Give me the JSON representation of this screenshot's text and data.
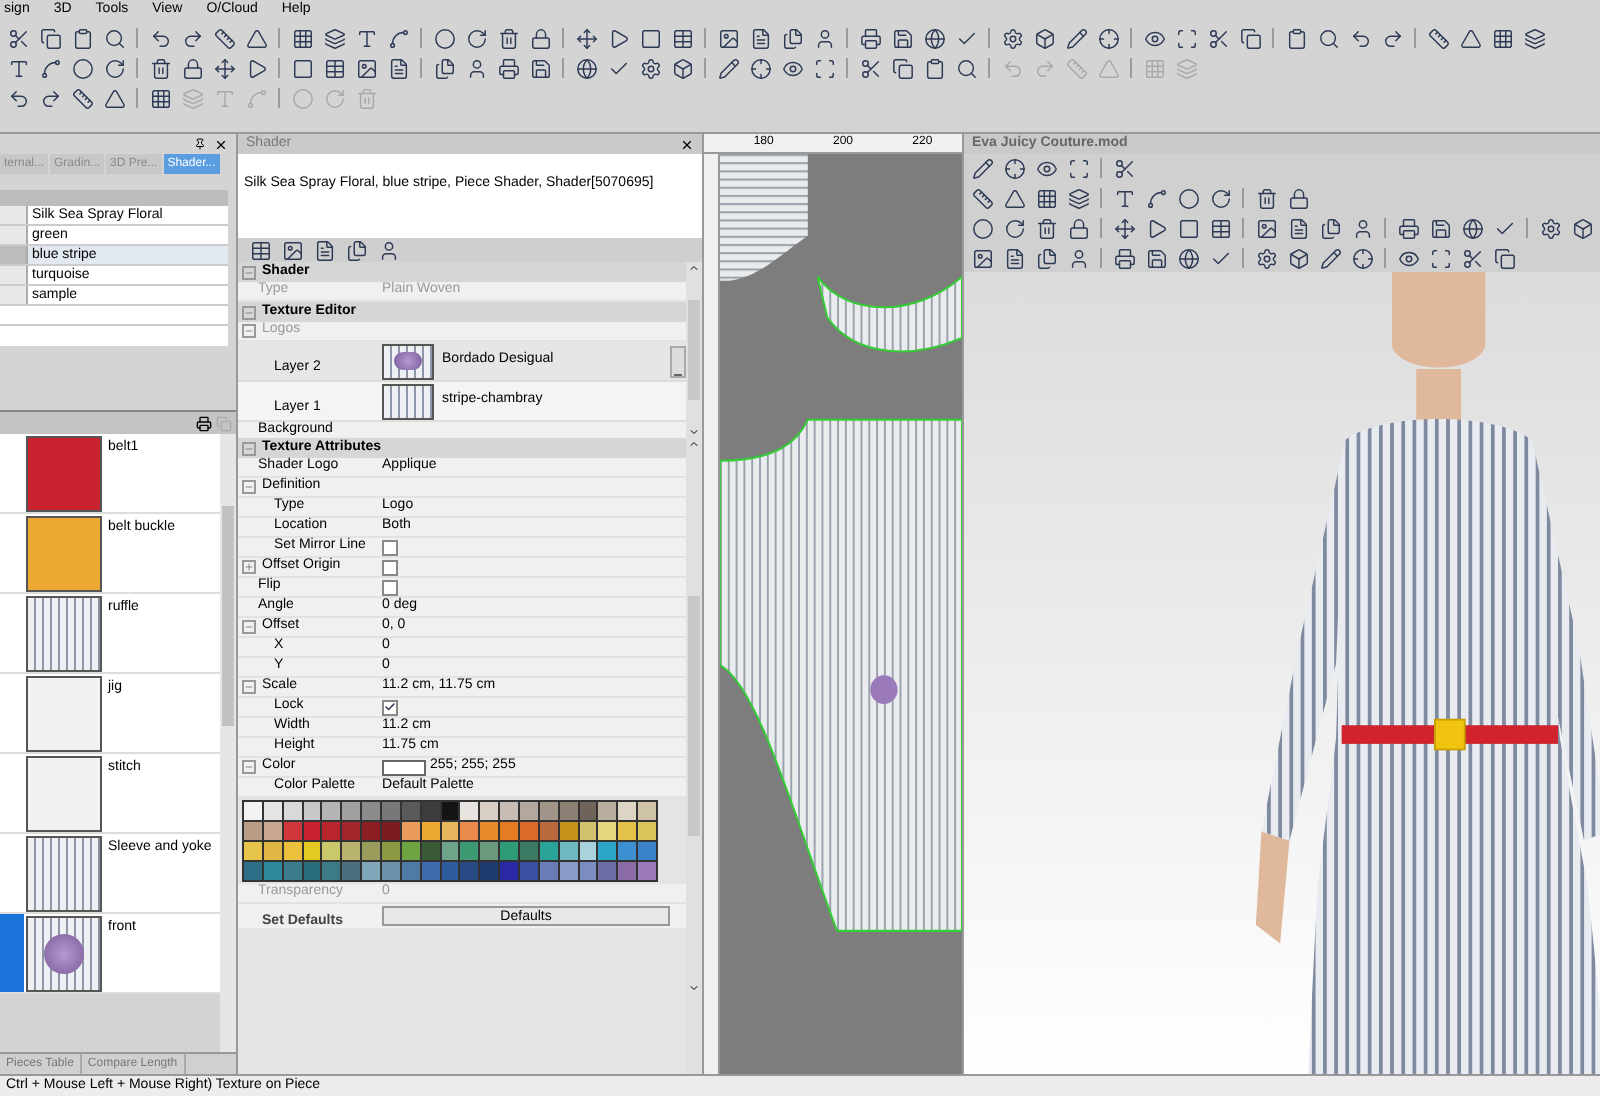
{
  "menu": [
    "sign",
    "3D",
    "Tools",
    "View",
    "O/Cloud",
    "Help"
  ],
  "left_panel": {
    "tabs": [
      {
        "label": "ternal...",
        "selected": false
      },
      {
        "label": "Gradin...",
        "selected": false
      },
      {
        "label": "3D Pre...",
        "selected": false
      },
      {
        "label": "Shader...",
        "selected": true
      }
    ],
    "table_rows": [
      {
        "name": "Silk Sea Spray Floral",
        "selected": false
      },
      {
        "name": "green",
        "selected": false
      },
      {
        "name": "blue stripe",
        "selected": true
      },
      {
        "name": "turquoise",
        "selected": false
      },
      {
        "name": "sample",
        "selected": false
      }
    ],
    "swatches": [
      {
        "name": "belt1",
        "kind": "solid",
        "color": "#c8232e",
        "selected": false
      },
      {
        "name": "belt buckle",
        "kind": "solid",
        "color": "#eba832",
        "selected": false
      },
      {
        "name": "ruffle",
        "kind": "stripe",
        "selected": false
      },
      {
        "name": "jig",
        "kind": "solid",
        "color": "#f1f1f1",
        "selected": false
      },
      {
        "name": "stitch",
        "kind": "solid",
        "color": "#f1f1f1",
        "selected": false
      },
      {
        "name": "Sleeve and yoke",
        "kind": "stripe",
        "selected": false
      },
      {
        "name": "front",
        "kind": "floral",
        "selected": true
      }
    ],
    "bottom_tabs": [
      "Pieces Table",
      "Compare Length"
    ]
  },
  "shader": {
    "title": "Shader",
    "description": "Silk Sea Spray Floral, blue stripe, Piece Shader, Shader[5070695]",
    "upper": [
      {
        "kind": "section",
        "label": "Shader",
        "expanded": true,
        "children": [
          {
            "kind": "prop",
            "label": "Type",
            "value": "Plain Woven",
            "disabled": true
          }
        ]
      },
      {
        "kind": "section",
        "label": "Texture Editor",
        "expanded": true,
        "children": [
          {
            "kind": "group",
            "label": "Logos",
            "disabled": true,
            "expanded": true,
            "children": [
              {
                "kind": "floral_layer",
                "label": "Layer  2",
                "value": "Bordado Desigual",
                "selected": true
              },
              {
                "kind": "stripe_layer",
                "label": "Layer  1",
                "value": "stripe-chambray",
                "selected": false
              }
            ]
          },
          {
            "kind": "prop",
            "label": "Background",
            "disabled": false
          }
        ]
      }
    ],
    "lower": [
      {
        "kind": "section",
        "label": "Texture Attributes",
        "expanded": true,
        "children": [
          {
            "kind": "prop",
            "label": "Shader Logo",
            "value": "Applique",
            "disabled": false
          },
          {
            "kind": "group",
            "label": "Definition",
            "expanded": true,
            "children": [
              {
                "kind": "prop",
                "label": "Type",
                "value": "Logo",
                "disabled": false
              },
              {
                "kind": "prop",
                "label": "Location",
                "value": "Both",
                "disabled": false
              },
              {
                "kind": "check",
                "label": "Set Mirror Line",
                "checked": false
              }
            ]
          },
          {
            "kind": "check",
            "label": "Offset Origin",
            "checked": false,
            "expanded": false
          },
          {
            "kind": "check",
            "label": "Flip",
            "checked": false
          },
          {
            "kind": "prop",
            "label": "Angle",
            "value": "0 deg",
            "disabled": false
          },
          {
            "kind": "group",
            "label": "Offset",
            "value": "0, 0",
            "expanded": true,
            "children": [
              {
                "kind": "prop",
                "label": "X",
                "value": "0",
                "disabled": false
              },
              {
                "kind": "prop",
                "label": "Y",
                "value": "0",
                "disabled": false
              }
            ]
          },
          {
            "kind": "group",
            "label": "Scale",
            "value": "11.2 cm, 11.75 cm",
            "expanded": true,
            "children": [
              {
                "kind": "check",
                "label": "Lock",
                "checked": true
              },
              {
                "kind": "prop",
                "label": "Width",
                "value": "11.2 cm",
                "disabled": false
              },
              {
                "kind": "prop",
                "label": "Height",
                "value": "11.75 cm",
                "disabled": false
              }
            ]
          },
          {
            "kind": "color",
            "label": "Color",
            "value": "255; 255; 255",
            "color": "#ffffff",
            "expanded": true,
            "children": [
              {
                "kind": "prop",
                "label": "Color Palette",
                "value": "Default Palette",
                "disabled": false
              },
              {
                "kind": "palette"
              }
            ]
          },
          {
            "kind": "prop",
            "label": "Transparency",
            "value": "0",
            "disabled": true
          },
          {
            "kind": "button",
            "label": "Set Defaults",
            "value": "Defaults"
          }
        ]
      }
    ],
    "palette": [
      [
        {
          "color": "#f2f2f2"
        },
        {
          "color": "#e6e6e6"
        },
        {
          "color": "#d9d9d9"
        },
        {
          "color": "#c8c8c8"
        },
        {
          "color": "#b4b4b4"
        },
        {
          "color": "#a0a0a0"
        },
        {
          "color": "#8c8c8c"
        },
        {
          "color": "#787878"
        },
        {
          "color": "#5a5a5a"
        },
        {
          "color": "#3c3c3c"
        },
        {
          "color": "#141414"
        },
        {
          "color": "#e8e4df"
        },
        {
          "color": "#d8cfc7"
        },
        {
          "color": "#c8bdb4"
        },
        {
          "color": "#b2a89f"
        },
        {
          "color": "#a09588"
        },
        {
          "color": "#8c8075"
        },
        {
          "color": "#6f645a"
        },
        {
          "color": "#b9ad9e"
        },
        {
          "color": "#dcd5c4"
        },
        {
          "color": "#cfc3a7"
        }
      ],
      [
        {
          "color": "#b89c86"
        },
        {
          "color": "#c9a891"
        },
        {
          "color": "#d0363c"
        },
        {
          "color": "#c8232e"
        },
        {
          "color": "#b9242d"
        },
        {
          "color": "#a3262c"
        },
        {
          "color": "#8c1d22"
        },
        {
          "color": "#7a1c20"
        },
        {
          "color": "#e89b5c"
        },
        {
          "color": "#eba832"
        },
        {
          "color": "#e9b55c"
        },
        {
          "color": "#ea8a4c"
        },
        {
          "color": "#e98b2c"
        },
        {
          "color": "#e57b22"
        },
        {
          "color": "#db6b2b"
        },
        {
          "color": "#b86a3c"
        },
        {
          "color": "#c7921c"
        },
        {
          "color": "#d3c26d"
        },
        {
          "color": "#e3d67d"
        },
        {
          "color": "#e5c34b"
        },
        {
          "color": "#d9c65a"
        }
      ],
      [
        {
          "color": "#e6c54a"
        },
        {
          "color": "#e0b743"
        },
        {
          "color": "#ecc03b"
        },
        {
          "color": "#e4c923"
        },
        {
          "color": "#c9c86a"
        },
        {
          "color": "#b8b46d"
        },
        {
          "color": "#9a9d5c"
        },
        {
          "color": "#8a9a43"
        },
        {
          "color": "#6ea442"
        },
        {
          "color": "#3b5a36"
        },
        {
          "color": "#6ea48a"
        },
        {
          "color": "#3d9a73"
        },
        {
          "color": "#6b9a7e"
        },
        {
          "color": "#2f9c78"
        },
        {
          "color": "#3b7a62"
        },
        {
          "color": "#2aa398"
        },
        {
          "color": "#6fb9c2"
        },
        {
          "color": "#a9d3dc"
        },
        {
          "color": "#2ba6c9"
        },
        {
          "color": "#3c8fd0"
        },
        {
          "color": "#3a82c9"
        }
      ],
      [
        {
          "color": "#2c6f86"
        },
        {
          "color": "#2c8a9a"
        },
        {
          "color": "#3a7b8c"
        },
        {
          "color": "#2a6d7a"
        },
        {
          "color": "#3c7a88"
        },
        {
          "color": "#4b6e80"
        },
        {
          "color": "#7fa6b9"
        },
        {
          "color": "#6b91ab"
        },
        {
          "color": "#4f7aa6"
        },
        {
          "color": "#3c6cae"
        },
        {
          "color": "#2f5c9c"
        },
        {
          "color": "#274a84"
        },
        {
          "color": "#1f3a6e"
        },
        {
          "color": "#2a2aa6"
        },
        {
          "color": "#3c4ea0"
        },
        {
          "color": "#6a7cb8"
        },
        {
          "color": "#8b9bc9"
        },
        {
          "color": "#7a8cc0"
        },
        {
          "color": "#6b6ba6"
        },
        {
          "color": "#8a6ba6"
        },
        {
          "color": "#9a7ab8"
        }
      ]
    ]
  },
  "pattern_view": {
    "ruler_marks": [
      "180",
      "200",
      "220"
    ]
  },
  "viewer": {
    "title": "Eva Juicy Couture.mod"
  },
  "status_bar": "Ctrl + Mouse Left + Mouse Right) Texture on Piece"
}
